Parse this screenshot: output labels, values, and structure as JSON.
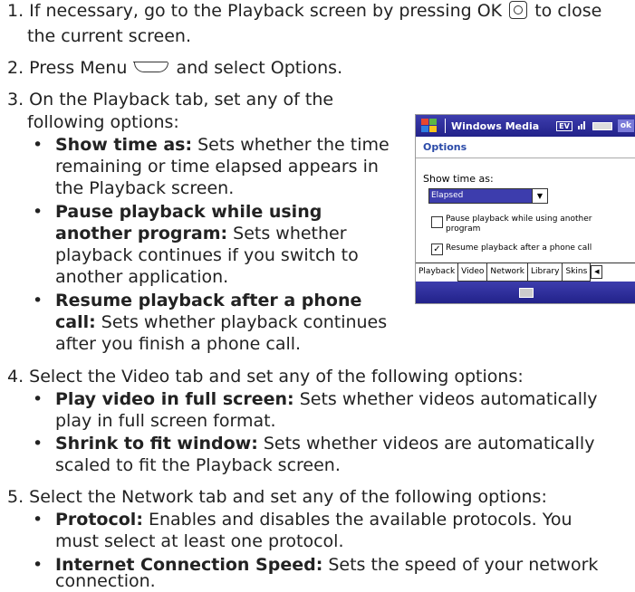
{
  "steps": {
    "s1": {
      "a": "1. If necessary, go to the Playback screen by pressing OK",
      "b": "to close",
      "c": "the current screen."
    },
    "s2": {
      "a": "2. Press Menu",
      "b": "and select Options."
    },
    "s3": {
      "a": "3. On the Playback tab, set any of the",
      "b": "following options:",
      "opt1": {
        "title": "Show time as:",
        "t1": "Sets whether the time",
        "t2": "remaining or time elapsed appears in",
        "t3": "the Playback screen."
      },
      "opt2": {
        "title1": "Pause playback while using",
        "title2": "another program:",
        "t1": "Sets whether",
        "t2": "playback continues if you switch to",
        "t3": "another application."
      },
      "opt3": {
        "title1": "Resume playback after a phone",
        "title2": "call:",
        "t1": "Sets whether playback continues",
        "t2": "after you finish a phone call."
      }
    },
    "s4": {
      "a": "4. Select the Video tab and set any of the following options:",
      "opt1": {
        "title": "Play video in full screen:",
        "t1": "Sets whether videos automatically",
        "t2": "play in full screen format."
      },
      "opt2": {
        "title": "Shrink to fit window:",
        "t1": "Sets whether videos are automatically",
        "t2": "scaled to fit the Playback screen."
      }
    },
    "s5": {
      "a": "5. Select the Network tab and set any of the following options:",
      "opt1": {
        "title": "Protocol:",
        "t1": "Enables and disables the available protocols. You",
        "t2": "must select at least one protocol."
      },
      "opt2": {
        "title": "Internet Connection Speed:",
        "t1": "Sets the speed of your network",
        "t2": "connection."
      }
    }
  },
  "bullet": "•",
  "phone": {
    "app_title": "Windows Media",
    "status_ev": "EV",
    "ok_label": "ok",
    "header": "Options",
    "show_time_label": "Show time as:",
    "dropdown_value": "Elapsed",
    "cb1_label": "Pause playback while using another program",
    "cb1_checked": false,
    "cb2_label": "Resume playback after a phone call",
    "cb2_checked": true,
    "check_mark": "✓",
    "dropdown_arrow": "▼",
    "tab_prev_arrow": "◀",
    "tabs": [
      "Playback",
      "Video",
      "Network",
      "Library",
      "Skins"
    ],
    "colors": {
      "title_bar": "#22228a",
      "header_text": "#2a4aa8",
      "selection": "#3d3dad"
    }
  },
  "icons": [
    "ok-button-icon",
    "menu-key-icon",
    "windows-flag-icon",
    "signal-icon",
    "battery-icon",
    "keyboard-icon"
  ]
}
